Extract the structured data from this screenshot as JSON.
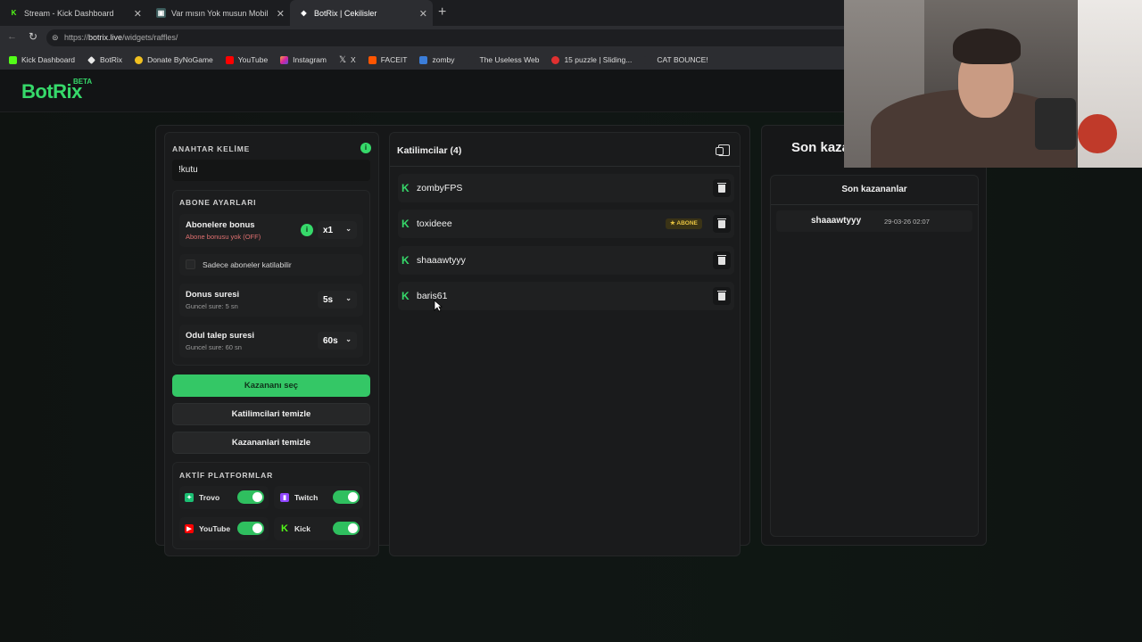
{
  "browser": {
    "tabs": [
      {
        "title": "Stream - Kick Dashboard",
        "active": false
      },
      {
        "title": "Var mısın Yok musun Mobil",
        "active": false
      },
      {
        "title": "BotRix | Cekilisler",
        "active": true
      }
    ],
    "url_scheme": "https://",
    "url_host": "botrix.live",
    "url_path": "/widgets/raffles/",
    "bookmarks": [
      "Kick Dashboard",
      "BotRix",
      "Donate ByNoGame",
      "YouTube",
      "Instagram",
      "X",
      "FACEIT",
      "zomby",
      "The Useless Web",
      "15 puzzle | Sliding...",
      "CAT BOUNCE!"
    ]
  },
  "brand": {
    "logo": "BotRix",
    "badge": "BETA",
    "accent": "#36d96a"
  },
  "settings": {
    "keyword_label": "ANAHTAR KELİME",
    "keyword_value": "!kutu",
    "sub_section_label": "ABONE AYARLARI",
    "sub_bonus_title": "Abonelere bonus",
    "sub_bonus_sub": "Abone bonusu yok (OFF)",
    "sub_bonus_value": "x1",
    "sub_only_label": "Sadece aboneler katilabilir",
    "bonus_time_title": "Donus suresi",
    "bonus_time_sub": "Guncel sure: 5 sn",
    "bonus_time_value": "5s",
    "claim_time_title": "Odul talep suresi",
    "claim_time_sub": "Guncel sure: 60 sn",
    "claim_time_value": "60s"
  },
  "actions": {
    "pick_winner": "Kazananı seç",
    "clear_participants": "Katilimcilari temizle",
    "clear_winners": "Kazananlari temizle"
  },
  "platforms": {
    "label": "AKTİF PLATFORMLAR",
    "items": [
      {
        "name": "Trovo",
        "enabled": true
      },
      {
        "name": "Twitch",
        "enabled": true
      },
      {
        "name": "YouTube",
        "enabled": true
      },
      {
        "name": "Kick",
        "enabled": true
      }
    ]
  },
  "participants": {
    "title": "Katilimcilar (4)",
    "subscriber_badge": "ABONE",
    "rows": [
      {
        "name": "zombyFPS",
        "subscriber": false
      },
      {
        "name": "toxideee",
        "subscriber": true
      },
      {
        "name": "shaaawtyyy",
        "subscriber": false
      },
      {
        "name": "baris61",
        "subscriber": false
      }
    ]
  },
  "winners": {
    "heading": "Son kaza",
    "title": "Son kazananlar",
    "rows": [
      {
        "name": "shaaawtyyy",
        "date": "29-03-26 02:07"
      }
    ]
  }
}
